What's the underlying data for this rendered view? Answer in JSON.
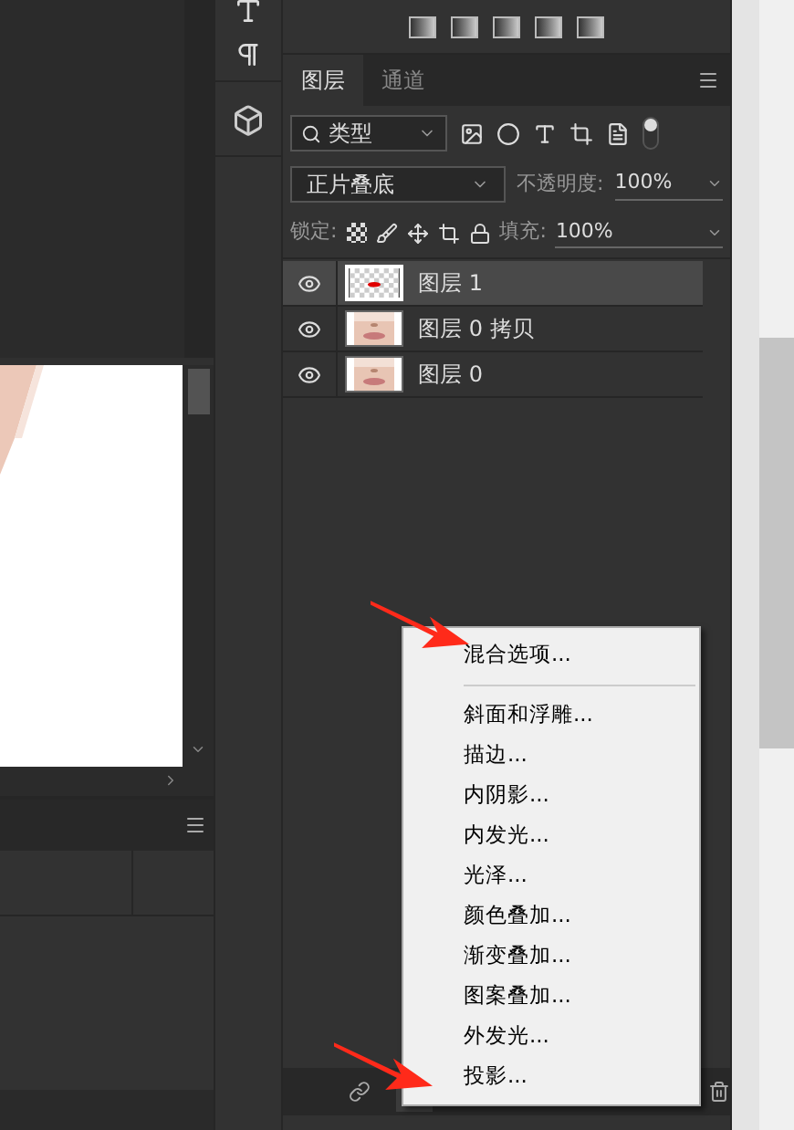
{
  "layers_panel": {
    "tabs": [
      {
        "label": "图层",
        "selected": true
      },
      {
        "label": "通道",
        "selected": false
      }
    ],
    "filter": {
      "value": "类型"
    },
    "blend_mode": {
      "value": "正片叠底"
    },
    "opacity": {
      "label": "不透明度:",
      "value": "100%"
    },
    "lock": {
      "label": "锁定:"
    },
    "fill": {
      "label": "填充:",
      "value": "100%"
    },
    "layers": [
      {
        "name": "图层 1",
        "selected": true,
        "visible": true,
        "kind": "transparent"
      },
      {
        "name": "图层 0 拷贝",
        "selected": false,
        "visible": true
      },
      {
        "name": "图层 0",
        "selected": false,
        "visible": true
      }
    ]
  },
  "context_menu": {
    "items": [
      {
        "kind": "item",
        "label": "混合选项..."
      },
      {
        "kind": "separator"
      },
      {
        "kind": "item",
        "label": "斜面和浮雕..."
      },
      {
        "kind": "item",
        "label": "描边..."
      },
      {
        "kind": "item",
        "label": "内阴影..."
      },
      {
        "kind": "item",
        "label": "内发光..."
      },
      {
        "kind": "item",
        "label": "光泽..."
      },
      {
        "kind": "item",
        "label": "颜色叠加..."
      },
      {
        "kind": "item",
        "label": "渐变叠加..."
      },
      {
        "kind": "item",
        "label": "图案叠加..."
      },
      {
        "kind": "item",
        "label": "外发光..."
      },
      {
        "kind": "item",
        "label": "投影..."
      }
    ]
  }
}
